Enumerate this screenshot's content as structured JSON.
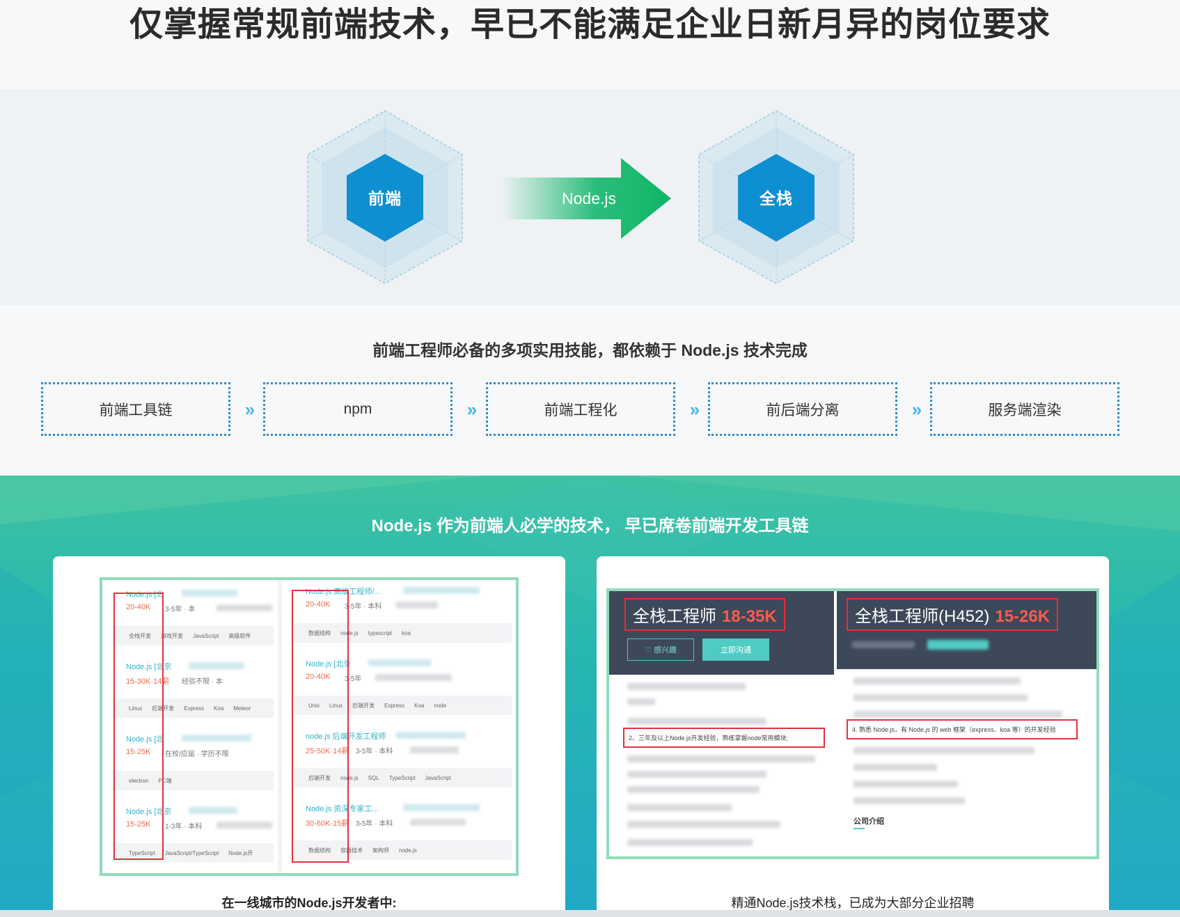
{
  "hero": {
    "title": "仅掌握常规前端技术，早已不能满足企业日新月异的岗位要求"
  },
  "transition": {
    "from": "前端",
    "via": "Node.js",
    "to": "全栈"
  },
  "skills": {
    "heading": "前端工程师必备的多项实用技能，都依赖于 Node.js 技术完成",
    "items": [
      "前端工具链",
      "npm",
      "前端工程化",
      "前后端分离",
      "服务端渲染"
    ]
  },
  "bottom": {
    "heading": "Node.js 作为前端人必学的技术， 早已席卷前端开发工具链",
    "left_card": {
      "caption": "在一线城市的Node.js开发者中:",
      "jobs_left": [
        {
          "title": "Node.js  [北",
          "salary": "20-40K",
          "meta": "3-5年  ·  本",
          "tags": [
            "全栈开发",
            "游戏开发",
            "JavaScript",
            "高级软件"
          ]
        },
        {
          "title": "Node.js  [北京",
          "salary": "15-30K·14薪",
          "meta": "经验不限  ·  本",
          "tags": [
            "Linux",
            "后端开发",
            "Express",
            "Koa",
            "Meteor"
          ]
        },
        {
          "title": "Node.js  [北",
          "salary": "15-25K",
          "meta": "在校/应届  ·  学历不限",
          "tags": [
            "electron",
            "PC端"
          ]
        },
        {
          "title": "Node.js  [北京",
          "salary": "15-25K",
          "meta": "1-3年  ·  本科",
          "tags": [
            "TypeScript",
            "JavaScript/TypeScript",
            "Node.js开"
          ]
        }
      ],
      "jobs_right": [
        {
          "title": "Node.js 高级工程师/...",
          "salary": "20-40K",
          "meta": "3-5年  ·  本科",
          "tags": [
            "数据结构",
            "node.js",
            "typescript",
            "koa"
          ]
        },
        {
          "title": "Node.js  [北京",
          "salary": "20-40K",
          "meta": "3-5年",
          "tags": [
            "Unix",
            "Linux",
            "后端开发",
            "Express",
            "Koa",
            "node"
          ]
        },
        {
          "title": "node.js 后端开发工程师",
          "salary": "25-50K·14薪",
          "meta": "3-5年  ·  本科",
          "tags": [
            "后端开发",
            "node.js",
            "SQL",
            "TypeScript",
            "JavaScript"
          ]
        },
        {
          "title": "Node.js 资深专家工...",
          "salary": "30-60K·15薪",
          "meta": "3-5年  ·  本科",
          "tags": [
            "数据结构",
            "容器技术",
            "架构师",
            "node.js"
          ]
        }
      ]
    },
    "right_card": {
      "caption": "精通Node.js技术栈，已成为大部分企业招聘",
      "job_a": {
        "title": "全栈工程师",
        "salary": "18-35K",
        "btn_interest": "♡ 感兴趣",
        "btn_chat": "立即沟通",
        "requirement": "2、三年及以上Node.js开发经验，熟练掌握node常用模块;"
      },
      "job_b": {
        "title": "全栈工程师(H452)",
        "salary": "15-26K",
        "requirement": "4. 熟悉 Node.js，有 Node.js 的 web 框架（express、koa 等）的开发经验",
        "company_label": "公司介绍"
      }
    }
  },
  "colors": {
    "hex_core": "#0e8fd1",
    "arrow": "#16b86e",
    "skill_border": "#2e8bd0",
    "highlight": "#e5303a",
    "salary": "#ff5a4d"
  }
}
